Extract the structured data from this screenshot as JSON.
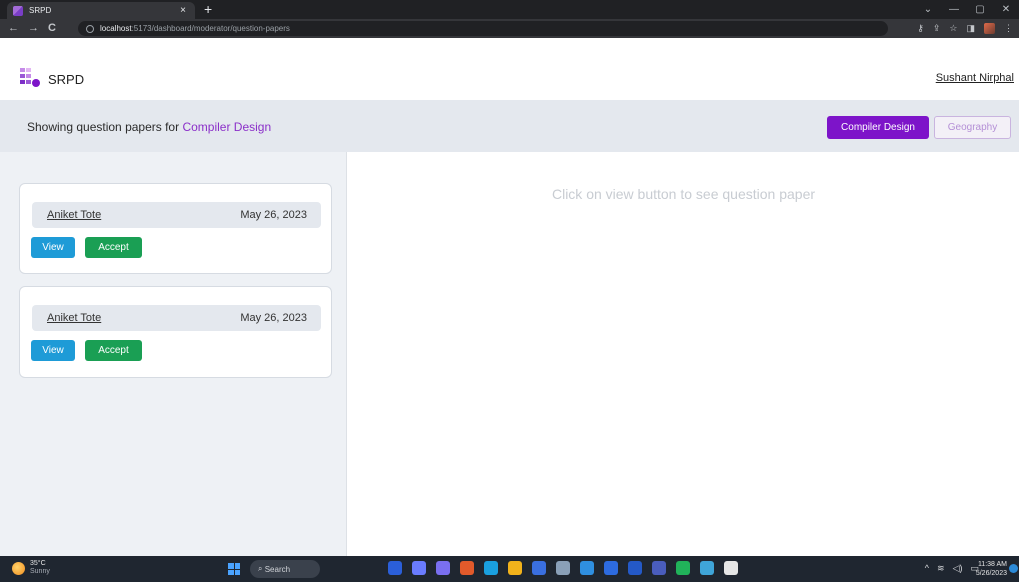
{
  "browser": {
    "tab_title": "SRPD",
    "tab_close": "×",
    "new_tab": "+",
    "url_host": "localhost",
    "url_path": ":5173/dashboard/moderator/question-papers",
    "nav_back": "←",
    "nav_forward": "→",
    "nav_reload": "C",
    "minimize": "—",
    "maximize": "▢",
    "close": "✕",
    "chevron": "⌄",
    "key_icon": "⚷",
    "share_icon": "⇪",
    "star_icon": "☆",
    "sidebar_icon": "◨",
    "menu_icon": "⋮"
  },
  "header": {
    "brand": "SRPD",
    "user_name": "Sushant Nirphal"
  },
  "subheader": {
    "prefix": "Showing question papers for",
    "subject": "Compiler Design",
    "subjects": [
      "Compiler Design",
      "Geography"
    ]
  },
  "papers": [
    {
      "author": "Aniket Tote",
      "date": "May 26, 2023",
      "view_label": "View",
      "accept_label": "Accept"
    },
    {
      "author": "Aniket Tote",
      "date": "May 26, 2023",
      "view_label": "View",
      "accept_label": "Accept"
    }
  ],
  "viewer": {
    "placeholder": "Click on view button to see question paper"
  },
  "taskbar": {
    "weather_temp": "35°C",
    "weather_cond": "Sunny",
    "search_label": "Search",
    "apps": [
      "#2b5fd9",
      "#6a7cff",
      "#7a6ff0",
      "#e25a2b",
      "#1aa0e0",
      "#f2b21b",
      "#3a6fe0",
      "#8aa0b8",
      "#2f8fe0",
      "#2d6be0",
      "#2459c7",
      "#4a5dbd",
      "#21b35a",
      "#3fa5d8",
      "#e6e6e6"
    ],
    "tray_chevron": "^",
    "tray_wifi": "≋",
    "tray_sound": "◁)",
    "tray_battery": "▭",
    "time": "11:38 AM",
    "date": "5/26/2023"
  }
}
